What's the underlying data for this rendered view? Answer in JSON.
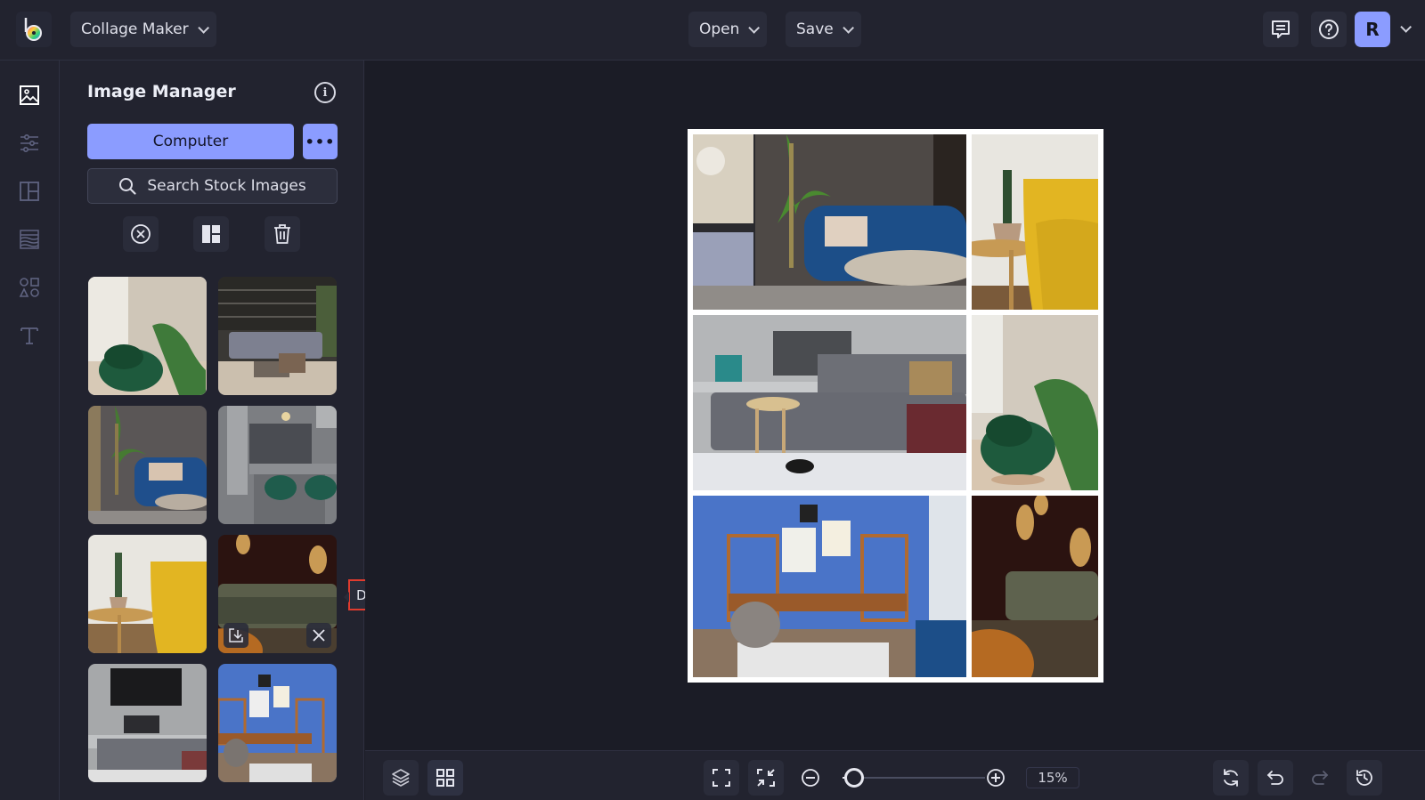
{
  "header": {
    "app_logo": "befunky-logo",
    "mode_label": "Collage Maker",
    "open_label": "Open",
    "save_label": "Save",
    "comments_icon": "comment-icon",
    "help_icon": "help-icon",
    "user_initial": "R"
  },
  "rail": {
    "items": [
      {
        "name": "image-manager",
        "icon": "image-icon",
        "active": true
      },
      {
        "name": "adjustments",
        "icon": "sliders-icon",
        "active": false
      },
      {
        "name": "layouts",
        "icon": "layout-icon",
        "active": false
      },
      {
        "name": "backgrounds",
        "icon": "texture-icon",
        "active": false
      },
      {
        "name": "graphics",
        "icon": "shapes-icon",
        "active": false
      },
      {
        "name": "text",
        "icon": "text-icon",
        "active": false
      }
    ]
  },
  "panel": {
    "title": "Image Manager",
    "computer_label": "Computer",
    "more_label": "•••",
    "search_label": "Search Stock Images",
    "tools": [
      "clear-icon",
      "autofill-icon",
      "trash-icon"
    ],
    "thumbnails": [
      {
        "subject": "green armchair with palm"
      },
      {
        "subject": "loft living room with gray sofa"
      },
      {
        "subject": "blue sofa with palm"
      },
      {
        "subject": "gray kitchen with green stools"
      },
      {
        "subject": "yellow chair with cactus"
      },
      {
        "subject": "olive sofa with edison bulbs",
        "hovered": true
      },
      {
        "subject": "gray sectional with city photo"
      },
      {
        "subject": "blue office with shelves"
      }
    ],
    "tooltip": "Drag or Double Click"
  },
  "collage": {
    "cells": [
      {
        "subject": "blue sofa with palm"
      },
      {
        "subject": "yellow chair with cactus"
      },
      {
        "subject": "gray sectional with city photo"
      },
      {
        "subject": "green armchair with palm"
      },
      {
        "subject": "blue office with shelves"
      },
      {
        "subject": "olive sofa with edison bulbs"
      }
    ]
  },
  "footer": {
    "zoom_percent": "15%",
    "zoom_slider_value": 0.08
  },
  "colors": {
    "accent": "#8b9cff",
    "tooltip_border": "#e13b2e",
    "panel_bg": "#22232f",
    "canvas_bg": "#1b1c26"
  }
}
